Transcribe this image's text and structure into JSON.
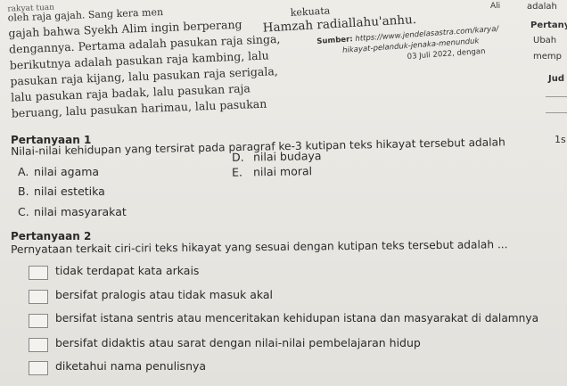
{
  "story": {
    "lines": [
      "rakyat tuan",
      "oleh raja gajah. Sang kera men",
      "gajah bahwa Syekh Alim ingin berperang",
      "dengannya. Pertama adalah pasukan raja singa,",
      "berikutnya adalah pasukan raja kambing, lalu",
      "pasukan raja kijang, lalu pasukan raja serigala,",
      "lalu pasukan raja badak, lalu pasukan raja",
      "beruang, lalu pasukan harimau, lalu pasukan"
    ],
    "col2_fragment": "kekuata",
    "col2_line": "Hamzah radiallahu'anhu.",
    "source_label": "Sumber:",
    "source_url": "https://www.jendelasastra.com/karya/",
    "source_url2": "hikayat-pelanduk-jenaka-menunduk",
    "source_date": "03 Juli 2022, dengan"
  },
  "right_column": {
    "top": "Ali",
    "line1": "adalah",
    "line2": "Pertany",
    "line3": "Ubah",
    "line4": "memp",
    "line5": "Jud",
    "line6": "1s"
  },
  "q1": {
    "heading": "Pertanyaan 1",
    "text": "Nilai-nilai kehidupan yang tersirat pada paragraf ke-3 kutipan teks hikayat tersebut adalah",
    "options": [
      {
        "letter": "A.",
        "text": "nilai agama"
      },
      {
        "letter": "B.",
        "text": "nilai estetika"
      },
      {
        "letter": "C.",
        "text": "nilai masyarakat"
      },
      {
        "letter": "D.",
        "text": "nilai budaya"
      },
      {
        "letter": "E.",
        "text": "nilai moral"
      }
    ]
  },
  "q2": {
    "heading": "Pertanyaan 2",
    "text": "Pernyataan terkait ciri-ciri teks hikayat yang sesuai dengan kutipan teks tersebut adalah ...",
    "options": [
      "tidak terdapat kata arkais",
      "bersifat pralogis atau tidak masuk akal",
      "bersifat istana sentris atau menceritakan kehidupan istana dan masyarakat di dalamnya",
      "bersifat didaktis atau sarat dengan nilai-nilai pembelajaran hidup",
      "diketahui nama penulisnya"
    ]
  }
}
